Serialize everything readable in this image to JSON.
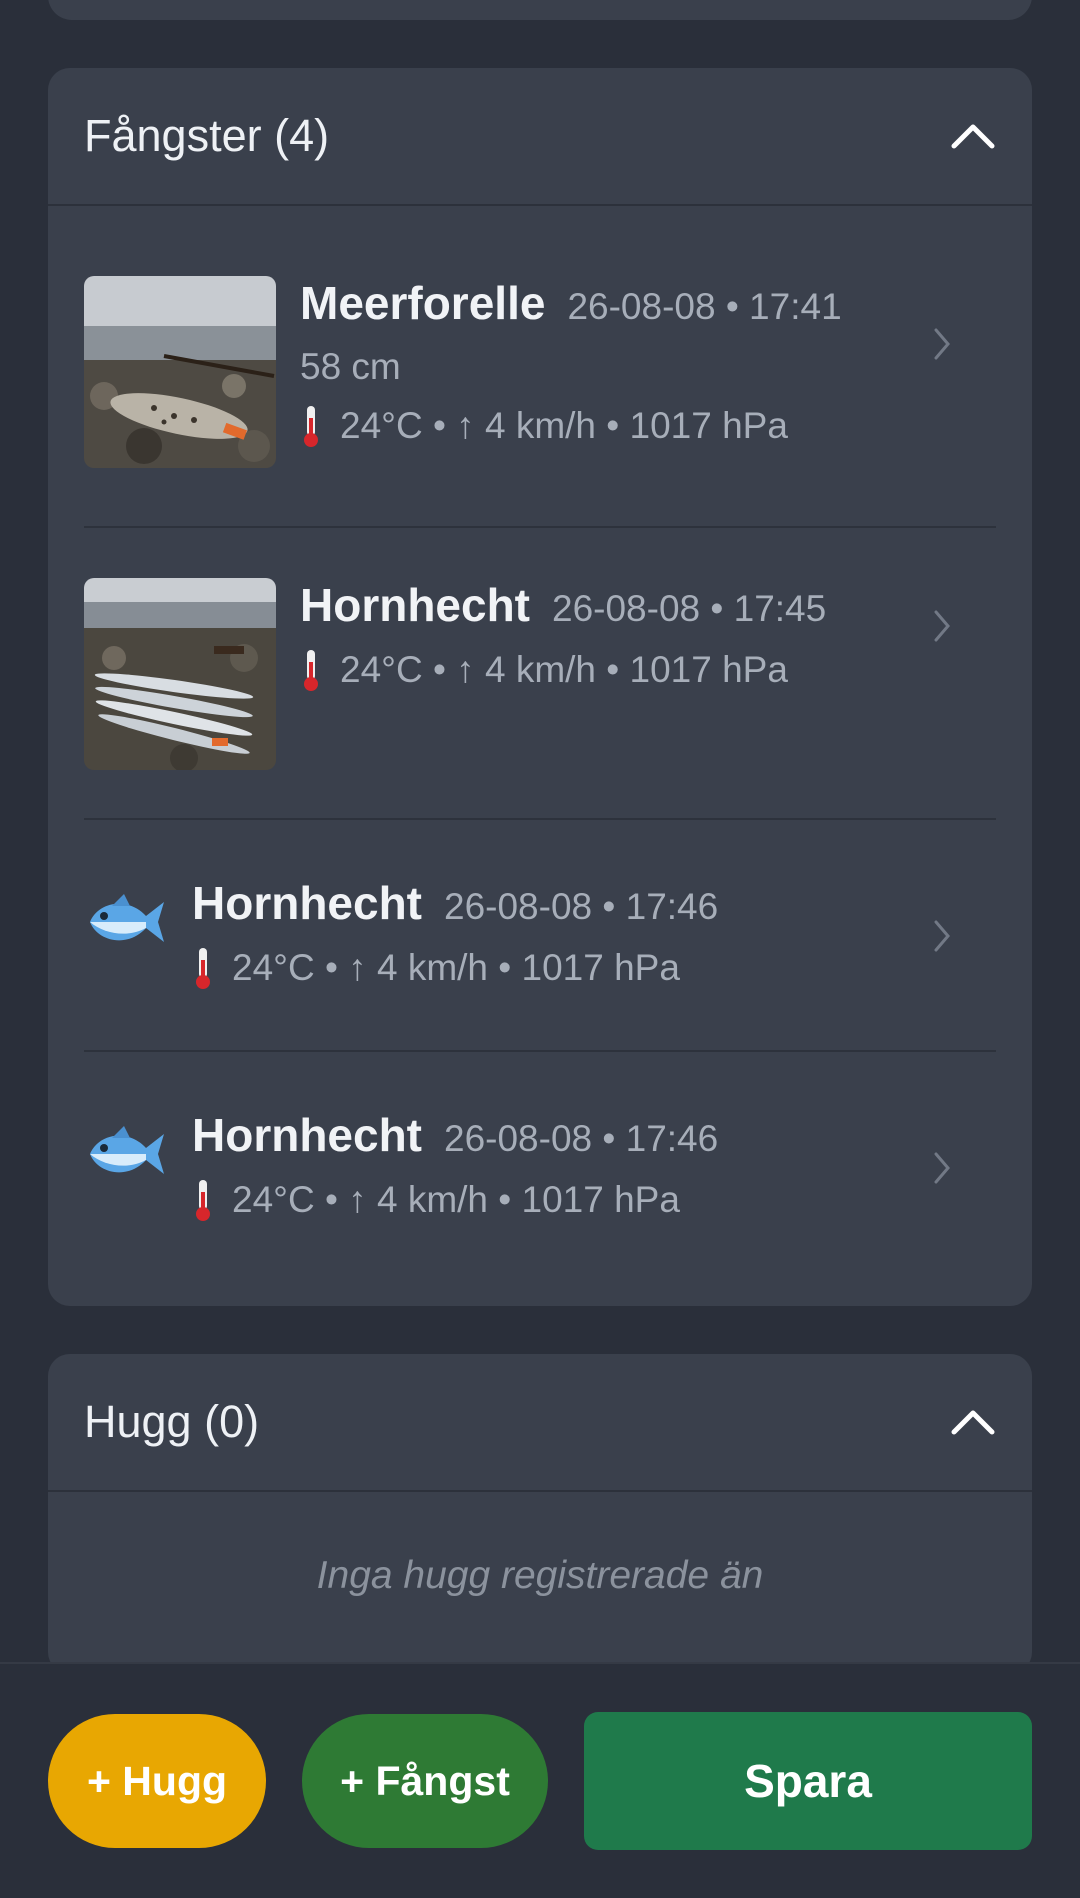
{
  "catches": {
    "title": "Fångster (4)",
    "items": [
      {
        "species": "Meerforelle",
        "datetime": "26-08-08 • 17:41",
        "length": "58 cm",
        "weather": "24°C • ↑ 4 km/h • 1017 hPa",
        "media": "photo-sea-trout"
      },
      {
        "species": "Hornhecht",
        "datetime": "26-08-08 • 17:45",
        "weather": "24°C • ↑ 4 km/h • 1017 hPa",
        "media": "photo-garfish"
      },
      {
        "species": "Hornhecht",
        "datetime": "26-08-08 • 17:46",
        "weather": "24°C • ↑ 4 km/h • 1017 hPa",
        "media": "fish-icon"
      },
      {
        "species": "Hornhecht",
        "datetime": "26-08-08 • 17:46",
        "weather": "24°C • ↑ 4 km/h • 1017 hPa",
        "media": "fish-icon"
      }
    ]
  },
  "bites": {
    "title": "Hugg (0)",
    "empty_text": "Inga hugg registrerade än"
  },
  "actions": {
    "add_bite": "+ Hugg",
    "add_catch": "+ Fångst",
    "save": "Spara"
  },
  "colors": {
    "background": "#2a2f3a",
    "card": "#3a404c",
    "bite_button": "#e8a702",
    "catch_button": "#2e7a34",
    "save_button": "#1f7a4b"
  }
}
